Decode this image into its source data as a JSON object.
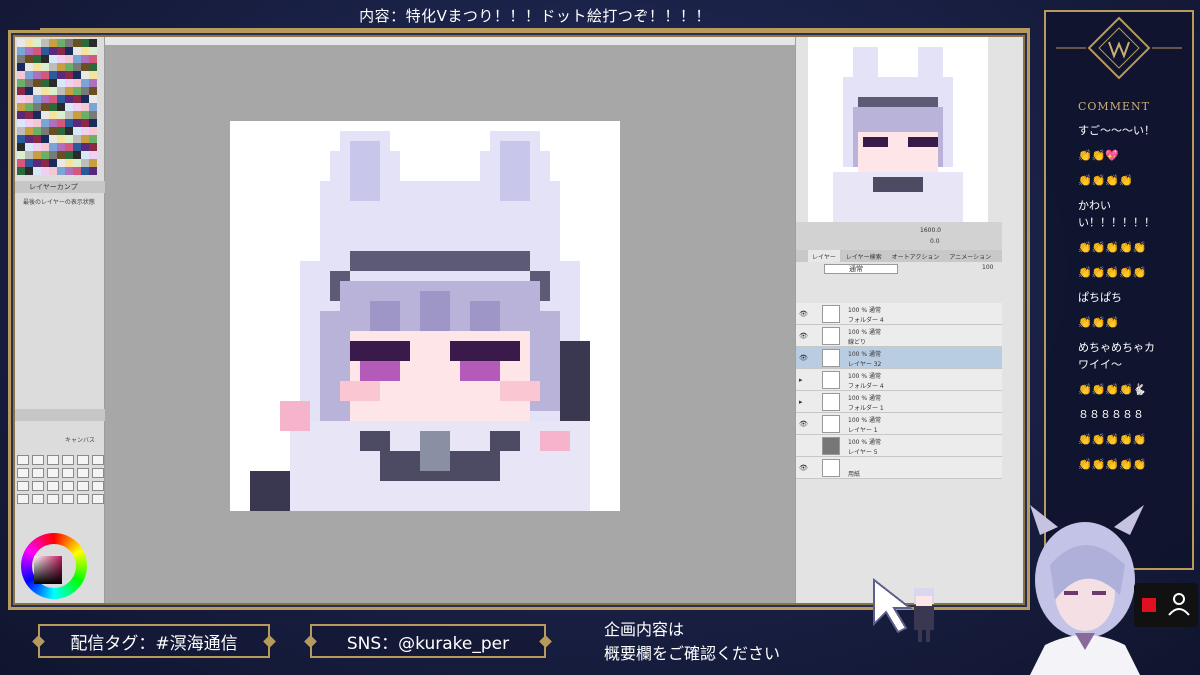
{
  "header": {
    "title": "内容：特化Vまつり！！！ドット絵打つぞ！！！！"
  },
  "app": {
    "left_panel": {
      "layer_comp_label": "レイヤーカンプ",
      "layer_comp_status": "最後のレイヤーの表示状態",
      "tool_property_label": "キャンバス"
    },
    "navigator": {
      "zoom": "1600.0",
      "rotate": "0.0"
    },
    "layer_panel": {
      "tabs": [
        "レイヤー",
        "レイヤー検索",
        "オートアクション",
        "アニメーション"
      ],
      "blend_mode": "通常",
      "opacity": "100",
      "layers": [
        {
          "line1": "100 % 通常",
          "line2": "フォルダー 4",
          "selected": false
        },
        {
          "line1": "100 % 通常",
          "line2": "線どり",
          "selected": false
        },
        {
          "line1": "100 % 通常",
          "line2": "レイヤー 32",
          "selected": true
        },
        {
          "line1": "100 % 通常",
          "line2": "フォルダー 4",
          "selected": false
        },
        {
          "line1": "100 % 通常",
          "line2": "フォルダー 1",
          "selected": false
        },
        {
          "line1": "100 % 通常",
          "line2": "レイヤー 1",
          "selected": false
        },
        {
          "line1": "100 % 通常",
          "line2": "レイヤー 5",
          "selected": false
        },
        {
          "line1": "",
          "line2": "用紙",
          "selected": false
        }
      ]
    }
  },
  "comments": {
    "heading": "COMMENT",
    "items": [
      "すご〜〜〜い！",
      "👏👏💖",
      "👏👏👏👏",
      "かわいい！！！！！！",
      "👏👏👏👏👏",
      "👏👏👏👏👏",
      "ぱちぱち",
      "👏👏👏",
      "めちゃめちゃカワイイ〜",
      "👏👏👏👏🐇",
      "８８８８８８",
      "👏👏👏👏👏",
      "👏👏👏👏👏"
    ]
  },
  "footer": {
    "stream_tag": "配信タグ：#溟海通信",
    "sns": "SNS：@kurake_per",
    "notice_line1": "企画内容は",
    "notice_line2": "概要欄をご確認ください"
  },
  "colors": {
    "gold": "#b79a5c",
    "navy": "#1b2245",
    "rec": "#e01020"
  },
  "icons": {
    "record": "record-icon",
    "user": "user-icon"
  }
}
